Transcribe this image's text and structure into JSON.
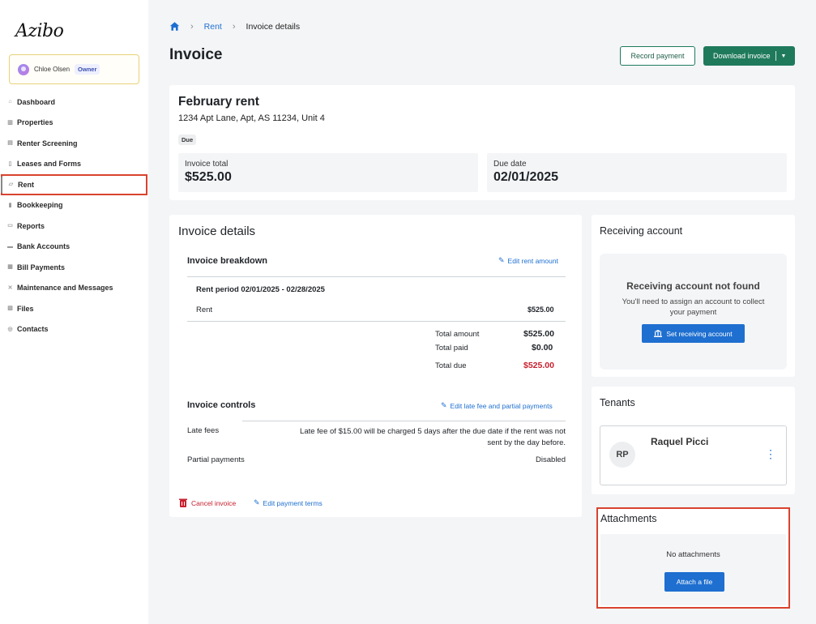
{
  "app": {
    "logo": "Azibo"
  },
  "user": {
    "name": "Chloe Olsen",
    "role": "Owner"
  },
  "sidebar": {
    "items": [
      {
        "label": "Dashboard",
        "icon": "home-icon"
      },
      {
        "label": "Properties",
        "icon": "building-icon"
      },
      {
        "label": "Renter Screening",
        "icon": "clipboard-icon"
      },
      {
        "label": "Leases and Forms",
        "icon": "document-icon"
      },
      {
        "label": "Rent",
        "icon": "chart-icon",
        "active": true
      },
      {
        "label": "Bookkeeping",
        "icon": "book-icon"
      },
      {
        "label": "Reports",
        "icon": "report-icon"
      },
      {
        "label": "Bank Accounts",
        "icon": "bank-icon"
      },
      {
        "label": "Bill Payments",
        "icon": "bill-icon"
      },
      {
        "label": "Maintenance and Messages",
        "icon": "wrench-icon"
      },
      {
        "label": "Files",
        "icon": "folder-icon"
      },
      {
        "label": "Contacts",
        "icon": "contacts-icon"
      }
    ]
  },
  "breadcrumb": {
    "home_icon": "home-icon",
    "rent": "Rent",
    "current": "Invoice details"
  },
  "header": {
    "title": "Invoice",
    "record_payment": "Record payment",
    "download_invoice": "Download invoice"
  },
  "summary": {
    "title": "February rent",
    "address": "1234 Apt Lane, Apt, AS 11234, Unit 4",
    "status": "Due",
    "invoice_total_label": "Invoice total",
    "invoice_total": "$525.00",
    "due_date_label": "Due date",
    "due_date": "02/01/2025"
  },
  "details": {
    "title": "Invoice details",
    "breakdown_title": "Invoice breakdown",
    "edit_rent": "Edit rent amount",
    "period": "Rent period 02/01/2025 - 02/28/2025",
    "rent_label": "Rent",
    "rent_value": "$525.00",
    "total_amount_label": "Total amount",
    "total_amount": "$525.00",
    "total_paid_label": "Total paid",
    "total_paid": "$0.00",
    "total_due_label": "Total due",
    "total_due": "$525.00",
    "controls_title": "Invoice controls",
    "edit_controls": "Edit late fee and partial payments",
    "late_fees_label": "Late fees",
    "late_fees_line1": "Late fee of $15.00 will be charged 5 days after the due date if the rent was not",
    "late_fees_line2": "sent by the day before.",
    "partial_label": "Partial payments",
    "partial_value": "Disabled",
    "cancel": "Cancel invoice",
    "edit_terms": "Edit payment terms"
  },
  "receiving": {
    "title": "Receiving account",
    "not_found": "Receiving account not found",
    "message_line1": "You'll need to assign an account to collect",
    "message_line2": "your payment",
    "button": "Set receiving account"
  },
  "tenants": {
    "title": "Tenants",
    "initials": "RP",
    "name": "Raquel Picci"
  },
  "attachments": {
    "title": "Attachments",
    "empty": "No attachments",
    "button": "Attach a file"
  },
  "colors": {
    "brand_green": "#1f7a5c",
    "link_blue": "#1e6fd0",
    "due_red": "#c8202f",
    "highlight": "#d9432f"
  }
}
